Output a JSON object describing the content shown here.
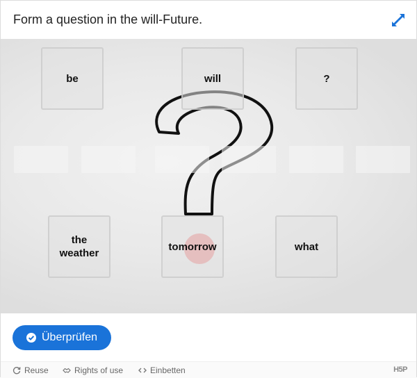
{
  "header": {
    "title": "Form a question in the will-Future."
  },
  "draggables": {
    "top": [
      "be",
      "will",
      "?"
    ],
    "bottom_0_line1": "the",
    "bottom_0_line2": "weather",
    "bottom_1": "tomorrow",
    "bottom_2": "what"
  },
  "dropzones": {
    "count": 6
  },
  "check": {
    "label": "Überprüfen"
  },
  "actions": {
    "reuse": "Reuse",
    "rights": "Rights of use",
    "embed": "Einbetten",
    "logo": "H5P"
  },
  "colors": {
    "accent": "#1a73d9",
    "question_mark_stroke": "#111111",
    "dot": "#e8787a"
  },
  "icons": [
    "fullscreen-icon",
    "check-circle-icon",
    "reuse-icon",
    "rights-icon",
    "embed-icon"
  ]
}
